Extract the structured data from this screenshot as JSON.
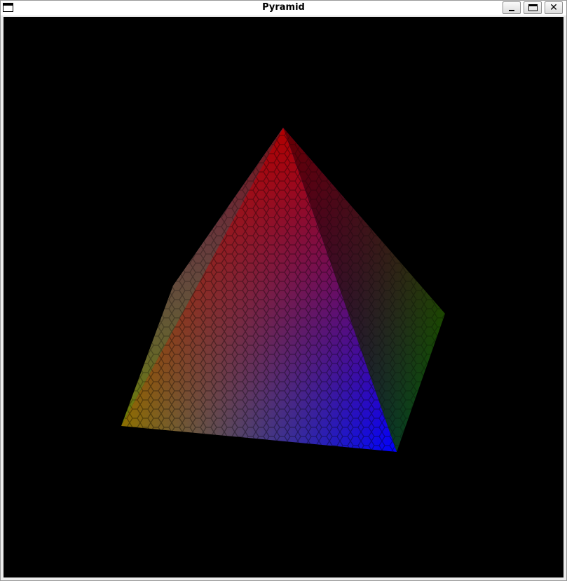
{
  "window": {
    "title": "Pyramid",
    "controls": {
      "minimize": "minimize",
      "maximize": "maximize",
      "close": "close"
    }
  },
  "canvas": {
    "background": "#000000",
    "faces": {
      "front": {
        "colors": [
          "#b10000",
          "#8a7a00",
          "#0000ff"
        ]
      },
      "right": {
        "colors": [
          "#b10000",
          "#1a8000",
          "#0000ff"
        ]
      },
      "left": {
        "colors": [
          "#b10000",
          "#2f7bd0",
          "#8a7a00"
        ]
      }
    }
  }
}
